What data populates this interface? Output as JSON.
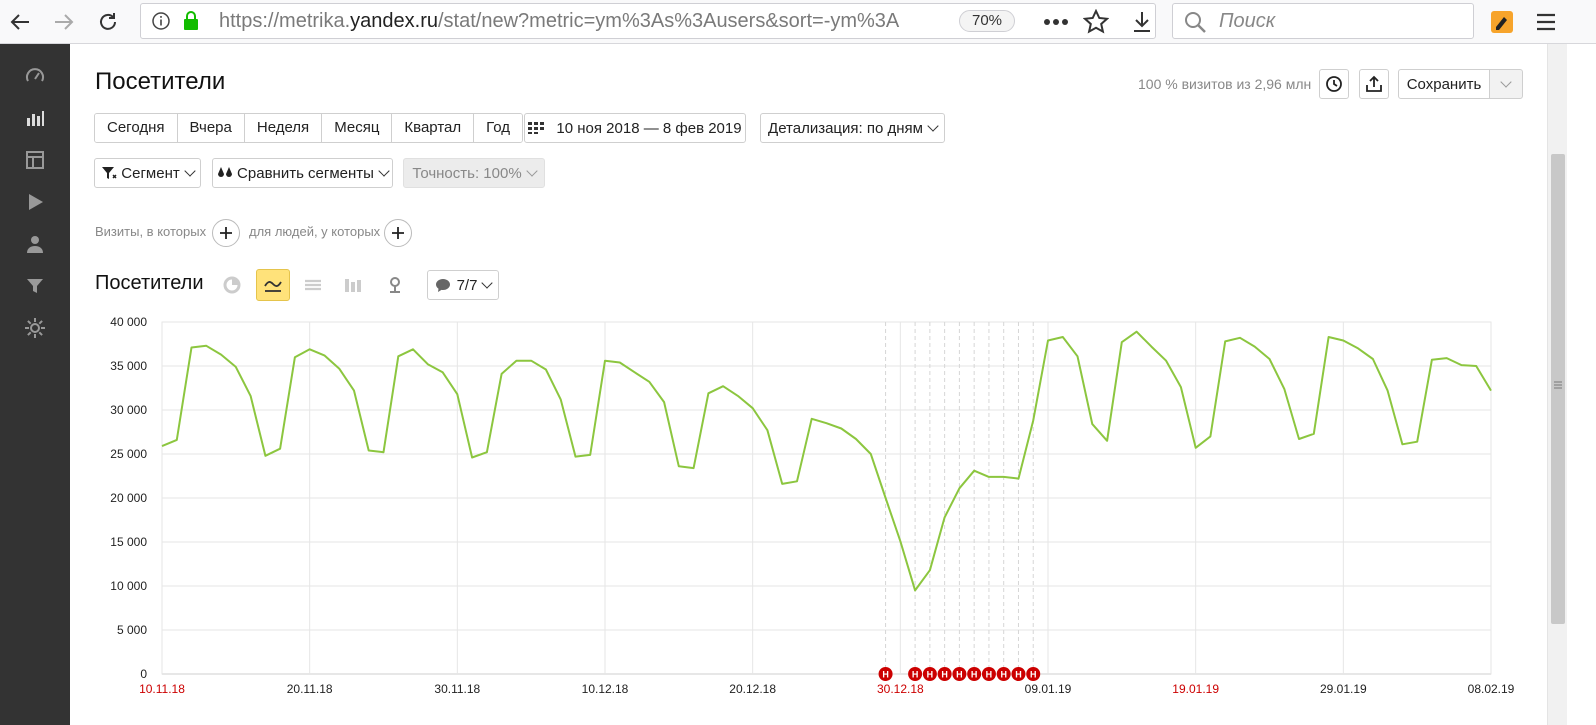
{
  "browser": {
    "url_prefix": "https://metrika.",
    "url_domain": "yandex.ru",
    "url_rest": "/stat/new?metric=ym%3As%3Ausers&sort=-ym%3A",
    "zoom": "70%",
    "search_placeholder": "Поиск"
  },
  "page": {
    "title": "Посетители",
    "visits_info": "100 % визитов из 2,96 млн",
    "save_label": "Сохранить"
  },
  "periods": [
    "Сегодня",
    "Вчера",
    "Неделя",
    "Месяц",
    "Квартал",
    "Год"
  ],
  "date_range": "10 ноя 2018 — 8 фев 2019",
  "detail": "Детализация: по дням",
  "filters": {
    "segment": "Сегмент",
    "compare": "Сравнить сегменты",
    "accuracy": "Точность: 100%",
    "visits_cond": "Визиты, в которых",
    "people_cond": "для людей, у которых"
  },
  "chart_header": {
    "title": "Посетители",
    "notes_count": "7/7"
  },
  "colors": {
    "line": "#8cc63f",
    "holiday": "#cc0000",
    "accent": "#ffe27a",
    "sidebar": "#333333"
  },
  "chart_data": {
    "type": "line",
    "x_start": "10.11.18",
    "x_end": "08.02.19",
    "x_tick_labels": [
      {
        "label": "10.11.18",
        "index": 0,
        "red": true
      },
      {
        "label": "20.11.18",
        "index": 10,
        "red": false
      },
      {
        "label": "30.11.18",
        "index": 20,
        "red": false
      },
      {
        "label": "10.12.18",
        "index": 30,
        "red": false
      },
      {
        "label": "20.12.18",
        "index": 40,
        "red": false
      },
      {
        "label": "30.12.18",
        "index": 50,
        "red": true
      },
      {
        "label": "09.01.19",
        "index": 60,
        "red": false
      },
      {
        "label": "19.01.19",
        "index": 70,
        "red": true
      },
      {
        "label": "29.01.19",
        "index": 80,
        "red": false
      },
      {
        "label": "08.02.19",
        "index": 90,
        "red": false
      }
    ],
    "y_ticks": [
      0,
      5000,
      10000,
      15000,
      20000,
      25000,
      30000,
      35000,
      40000
    ],
    "y_tick_labels": [
      "0",
      "5 000",
      "10 000",
      "15 000",
      "20 000",
      "25 000",
      "30 000",
      "35 000",
      "40 000"
    ],
    "ylim": [
      0,
      40000
    ],
    "grid": true,
    "holiday_marker_label": "Н",
    "holiday_indices": [
      49,
      51,
      52,
      53,
      54,
      55,
      56,
      57,
      58,
      59
    ],
    "values": [
      25900,
      26600,
      37100,
      37300,
      36300,
      34900,
      31600,
      24800,
      25600,
      36000,
      36900,
      36200,
      34700,
      32200,
      25400,
      25200,
      36100,
      36900,
      35200,
      34300,
      31800,
      24600,
      25200,
      34100,
      35600,
      35600,
      34600,
      31200,
      24700,
      24900,
      35600,
      35400,
      34300,
      33200,
      30900,
      23600,
      23400,
      31900,
      32700,
      31600,
      30200,
      27700,
      21600,
      21900,
      29000,
      28500,
      27900,
      26700,
      25000,
      20000,
      15100,
      9500,
      11800,
      17800,
      21100,
      23100,
      22400,
      22400,
      22200,
      28800,
      37900,
      38300,
      36100,
      28400,
      26500,
      37700,
      38900,
      37200,
      35600,
      32600,
      25700,
      27000,
      37800,
      38200,
      37200,
      35800,
      32400,
      26700,
      27300,
      38300,
      37900,
      37000,
      35800,
      32200,
      26100,
      26400,
      35700,
      35900,
      35100,
      35000,
      32200
    ]
  }
}
